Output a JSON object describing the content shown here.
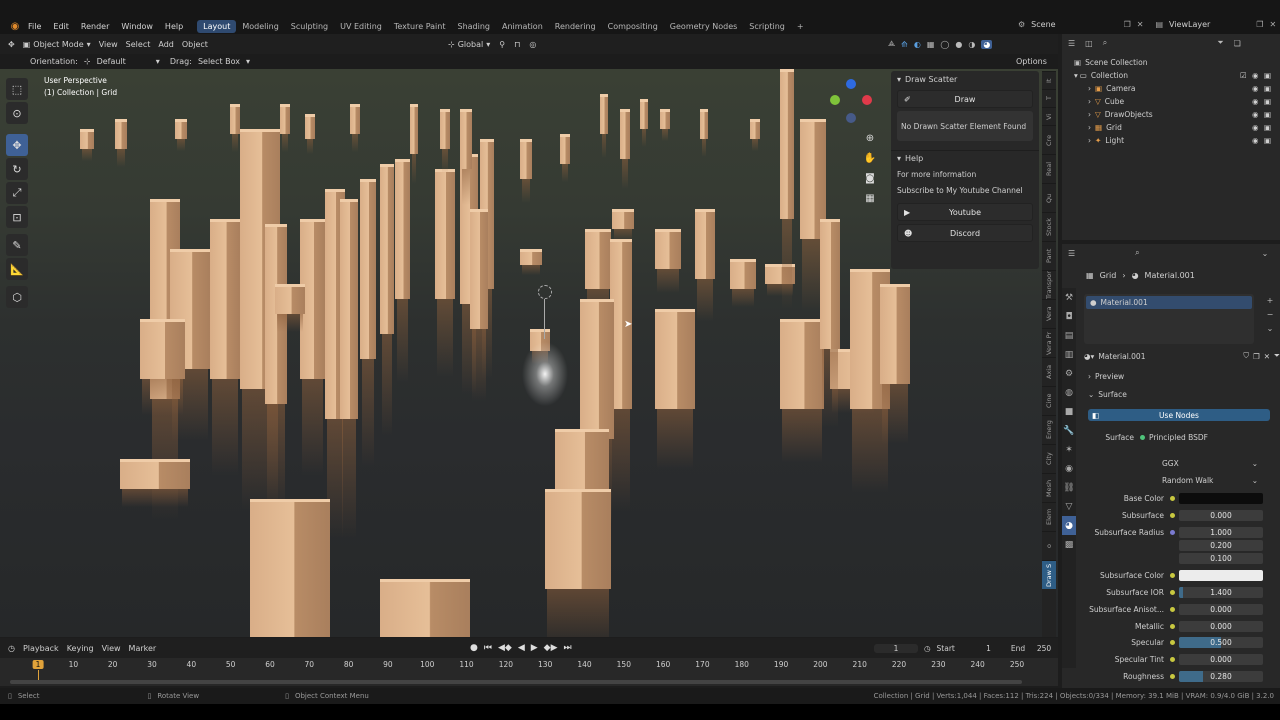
{
  "menubar": {
    "items": [
      "File",
      "Edit",
      "Render",
      "Window",
      "Help"
    ],
    "workspaces": [
      "Layout",
      "Modeling",
      "Sculpting",
      "UV Editing",
      "Texture Paint",
      "Shading",
      "Animation",
      "Rendering",
      "Compositing",
      "Geometry Nodes",
      "Scripting"
    ],
    "active_workspace": "Layout",
    "add_tab": "+",
    "scene": "Scene",
    "view_layer": "ViewLayer"
  },
  "viewport_header": {
    "mode": "Object Mode",
    "menus": [
      "View",
      "Select",
      "Add",
      "Object"
    ],
    "transform_orientation": "Global"
  },
  "tool_settings": {
    "orientation_label": "Orientation:",
    "orientation_value": "Default",
    "drag_label": "Drag:",
    "drag_value": "Select Box",
    "options": "Options"
  },
  "viewport": {
    "perspective": "User Perspective",
    "collection": "(1) Collection | Grid"
  },
  "npanel": {
    "draw_scatter_title": "Draw Scatter",
    "draw_button": "Draw",
    "no_element": "No Drawn Scatter Element Found",
    "help_title": "Help",
    "more_info": "For more information",
    "subscribe": "Subscribe to My Youtube Channel",
    "youtube": "Youtube",
    "discord": "Discord"
  },
  "vertical_tabs": [
    "It",
    "T",
    "Vi",
    "Cre",
    "Real",
    "Qu",
    "Stock",
    "Pant",
    "Transpor",
    "Vera",
    "Vera Pr",
    "Axia",
    "Cine",
    "Energ",
    "City",
    "Mesh",
    "Elem",
    "o",
    "Draw S"
  ],
  "active_vertical_tab": "Draw S",
  "outliner": {
    "scene_collection": "Scene Collection",
    "collection": "Collection",
    "items": [
      "Camera",
      "Cube",
      "DrawObjects",
      "Grid",
      "Light"
    ]
  },
  "properties": {
    "breadcrumb_object": "Grid",
    "breadcrumb_material": "Material.001",
    "slot": "Material.001",
    "material_name": "Material.001",
    "preview": "Preview",
    "surface_section": "Surface",
    "use_nodes": "Use Nodes",
    "surface_label": "Surface",
    "surface_value": "Principled BSDF",
    "distribution": "GGX",
    "subsurface_method": "Random Walk",
    "fields": [
      {
        "label": "Base Color",
        "value": "",
        "kind": "color_black"
      },
      {
        "label": "Subsurface",
        "value": "0.000",
        "kind": "num"
      },
      {
        "label": "Subsurface Radius",
        "value": "1.000",
        "kind": "num"
      },
      {
        "label": "",
        "value": "0.200",
        "kind": "num"
      },
      {
        "label": "",
        "value": "0.100",
        "kind": "num"
      },
      {
        "label": "Subsurface Color",
        "value": "",
        "kind": "color_white"
      },
      {
        "label": "Subsurface IOR",
        "value": "1.400",
        "kind": "num",
        "fill": 0.05
      },
      {
        "label": "Subsurface Anisot...",
        "value": "0.000",
        "kind": "num"
      },
      {
        "label": "Metallic",
        "value": "0.000",
        "kind": "num"
      },
      {
        "label": "Specular",
        "value": "0.500",
        "kind": "num",
        "fill": 0.5
      },
      {
        "label": "Specular Tint",
        "value": "0.000",
        "kind": "num"
      },
      {
        "label": "Roughness",
        "value": "0.280",
        "kind": "num",
        "fill": 0.28
      }
    ]
  },
  "timeline": {
    "menus": [
      "Playback",
      "Keying",
      "View",
      "Marker"
    ],
    "current_frame": "1",
    "start_label": "Start",
    "start": "1",
    "end_label": "End",
    "end": "250",
    "ticks": [
      "1",
      "10",
      "20",
      "30",
      "40",
      "50",
      "60",
      "70",
      "80",
      "90",
      "100",
      "110",
      "120",
      "130",
      "140",
      "150",
      "160",
      "170",
      "180",
      "190",
      "200",
      "210",
      "220",
      "230",
      "240",
      "250"
    ]
  },
  "statusbar": {
    "select": "Select",
    "rotate": "Rotate View",
    "context": "Object Context Menu",
    "stats": "Collection | Grid | Verts:1,044 | Faces:112 | Tris:224 | Objects:0/334 | Memory: 39.1 MiB | VRAM: 0.9/4.0 GiB | 3.2.0"
  },
  "colors": {
    "accent": "#2f4a70",
    "active_tab": "#2e5d85",
    "pillar": "#e2b995"
  }
}
